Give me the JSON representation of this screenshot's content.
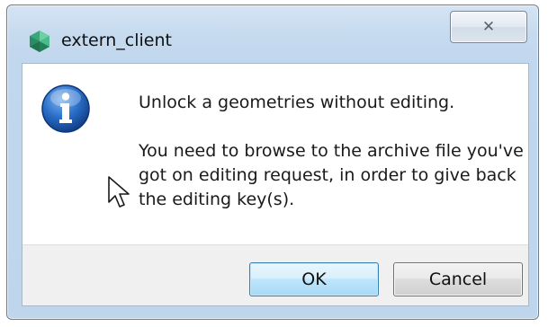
{
  "window": {
    "title": "extern_client",
    "close_glyph": "✕"
  },
  "message": {
    "main": "Unlock a geometries without editing.",
    "detail": "You need to browse to the archive file you've got on editing request, in order to give back the editing key(s)."
  },
  "buttons": {
    "ok_label": "OK",
    "cancel_label": "Cancel"
  },
  "icons": {
    "app": "app-icon",
    "info": "information-icon",
    "cursor": "mouse-pointer"
  },
  "colors": {
    "frame": "#c1d7ed",
    "ok_border": "#3c7fb1",
    "info_blue": "#1f5fb8"
  }
}
